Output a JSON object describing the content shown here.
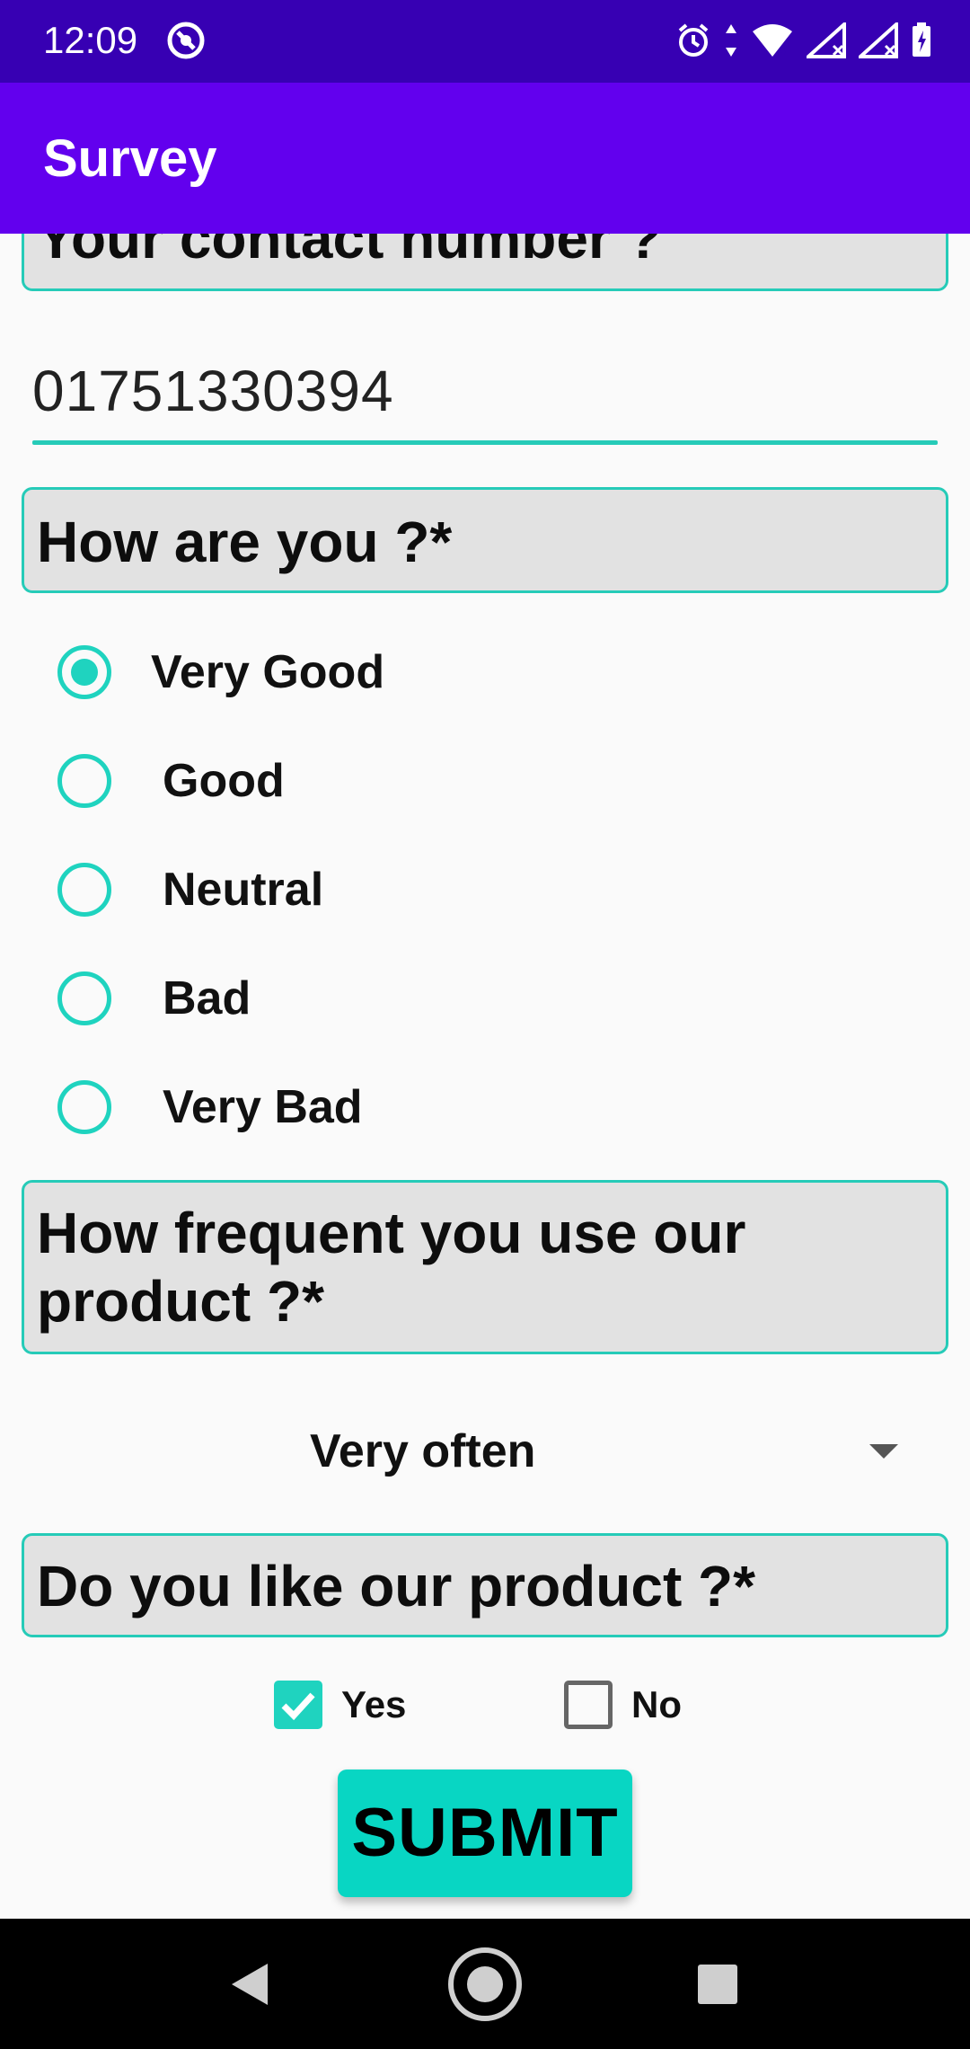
{
  "status_bar": {
    "time": "12:09"
  },
  "app_bar": {
    "title": "Survey"
  },
  "contact": {
    "question": "Your contact number ?",
    "value": "01751330394"
  },
  "feeling": {
    "question": "How are you ?*",
    "options": [
      "Very Good",
      "Good",
      "Neutral",
      "Bad",
      "Very Bad"
    ],
    "selected": "Very Good"
  },
  "frequency": {
    "question_line1": "How frequent you use our",
    "question_line2": "product ?*",
    "selected": "Very often"
  },
  "like": {
    "question": "Do you like our product ?*",
    "yes_label": "Yes",
    "no_label": "No",
    "yes_checked": true,
    "no_checked": false
  },
  "submit": {
    "label": "SUBMIT"
  },
  "colors": {
    "status_bar": "#3700b3",
    "app_bar": "#6200ee",
    "accent": "#1fd3bf",
    "submit": "#08d6c3"
  }
}
